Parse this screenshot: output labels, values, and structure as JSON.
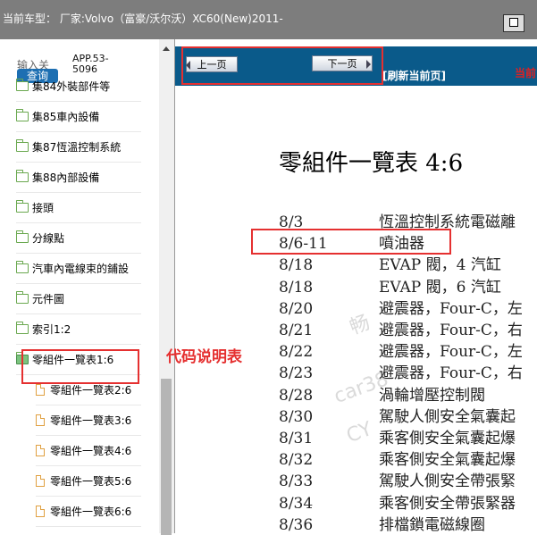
{
  "header": {
    "model_text": "当前车型： 厂家:Volvo（富豪/沃尔沃）XC60(New)2011-",
    "window_icon": "window-toggle-icon"
  },
  "sidebar": {
    "input_label": "输入关",
    "query_button": "查询",
    "app_code": "APP.53-5096",
    "items": [
      {
        "label": "集84外裝部件等",
        "icon": "folder-icon"
      },
      {
        "label": "集85車內設備",
        "icon": "folder-icon"
      },
      {
        "label": "集87恆溫控制系統",
        "icon": "folder-icon"
      },
      {
        "label": "集88內部設備",
        "icon": "folder-icon"
      },
      {
        "label": "接頭",
        "icon": "folder-icon"
      },
      {
        "label": "分線點",
        "icon": "folder-icon"
      },
      {
        "label": "汽車內電線束的鋪設",
        "icon": "folder-icon"
      },
      {
        "label": "元件圖",
        "icon": "folder-icon"
      },
      {
        "label": "索引1:2",
        "icon": "folder-icon"
      },
      {
        "label": "零組件一覽表1:6",
        "icon": "folder-open-icon"
      }
    ],
    "children": [
      {
        "label": "零組件一覽表2:6",
        "icon": "file-icon"
      },
      {
        "label": "零組件一覽表3:6",
        "icon": "file-icon"
      },
      {
        "label": "零組件一覽表4:6",
        "icon": "file-icon"
      },
      {
        "label": "零組件一覽表5:6",
        "icon": "file-icon"
      },
      {
        "label": "零組件一覽表6:6",
        "icon": "file-icon"
      }
    ]
  },
  "toolbar": {
    "prev_label": "上一页",
    "next_label": "下一页",
    "refresh_label": "[刷新当前页]",
    "current_label": "当前"
  },
  "annotation": {
    "label": "代码说明表"
  },
  "document": {
    "title": "零組件一覽表 4:6",
    "rows": [
      {
        "code": "8/3",
        "desc": "恆溫控制系統電磁離"
      },
      {
        "code": "8/6-11",
        "desc": "噴油器"
      },
      {
        "code": "8/18",
        "desc": "EVAP 閥，4 汽缸"
      },
      {
        "code": "8/18",
        "desc": "EVAP 閥，6 汽缸"
      },
      {
        "code": "8/20",
        "desc": "避震器，Four-C，左"
      },
      {
        "code": "8/21",
        "desc": "避震器，Four-C，右"
      },
      {
        "code": "8/22",
        "desc": "避震器，Four-C，左"
      },
      {
        "code": "8/23",
        "desc": "避震器，Four-C，右"
      },
      {
        "code": "8/28",
        "desc": "渦輪增壓控制閥"
      },
      {
        "code": "8/30",
        "desc": "駕駛人側安全氣囊起"
      },
      {
        "code": "8/31",
        "desc": "乘客側安全氣囊起爆"
      },
      {
        "code": "8/32",
        "desc": "乘客側安全氣囊起爆"
      },
      {
        "code": "8/33",
        "desc": "駕駛人側安全帶張緊"
      },
      {
        "code": "8/34",
        "desc": "乘客側安全帶張緊器"
      },
      {
        "code": "8/36",
        "desc": "排檔鎖電磁線圈"
      }
    ],
    "watermark": [
      "畅",
      "car38",
      "CY"
    ]
  },
  "colors": {
    "toolbar_bg": "#0a5a8a",
    "annotation": "#e53030",
    "header_bg": "#7d7d7d"
  }
}
